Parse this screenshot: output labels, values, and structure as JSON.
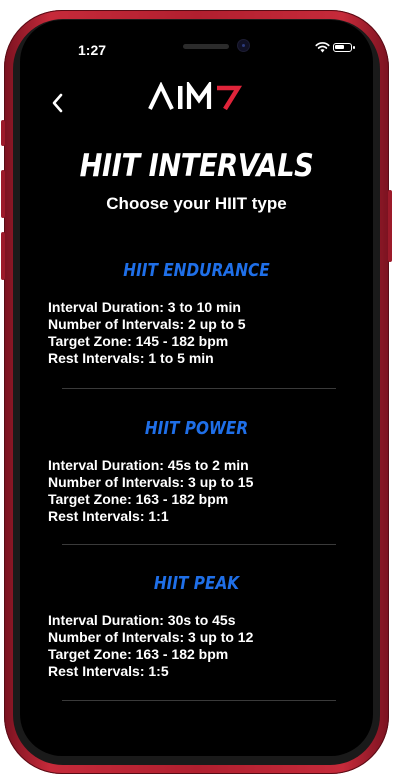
{
  "status_bar": {
    "time": "1:27"
  },
  "header": {
    "brand": "AIM7"
  },
  "page": {
    "title": "HIIT INTERVALS",
    "subtitle": "Choose your HIIT type"
  },
  "hiit_types": [
    {
      "name": "HIIT ENDURANCE",
      "lines": [
        "Interval Duration: 3 to 10 min",
        "Number of Intervals: 2 up to 5",
        "Target Zone: 145 - 182 bpm",
        "Rest Intervals: 1 to 5 min"
      ]
    },
    {
      "name": "HIIT POWER",
      "lines": [
        "Interval Duration: 45s to 2 min",
        "Number of Intervals: 3 up to 15",
        "Target Zone: 163 - 182 bpm",
        "Rest Intervals: 1:1"
      ]
    },
    {
      "name": "HIIT PEAK",
      "lines": [
        "Interval Duration: 30s to 45s",
        "Number of Intervals: 3 up to 12",
        "Target Zone: 163 - 182 bpm",
        "Rest Intervals: 1:5"
      ]
    }
  ],
  "colors": {
    "accent": "#1f6fe8",
    "brand_red": "#e0243a",
    "background": "#000000",
    "phone_frame": "#b11f2f"
  }
}
